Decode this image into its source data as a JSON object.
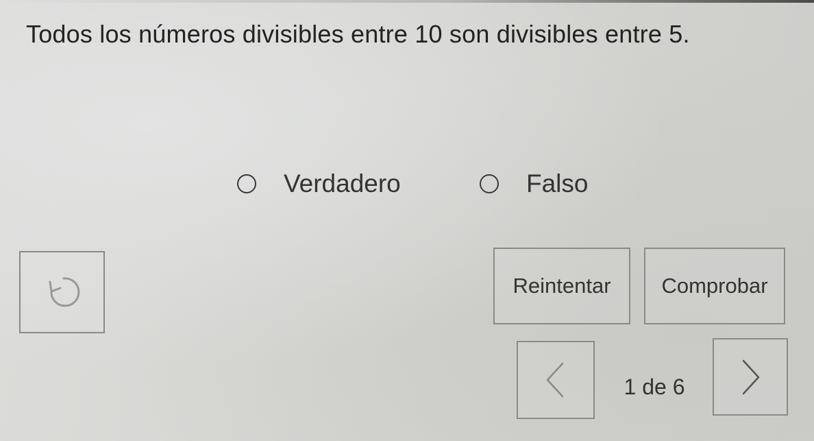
{
  "question": {
    "text": "Todos los números divisibles entre 10 son divisibles entre 5."
  },
  "options": [
    {
      "label": "Verdadero",
      "selected": false
    },
    {
      "label": "Falso",
      "selected": false
    }
  ],
  "actions": {
    "reset_icon": "undo-arrow-icon",
    "retry_label": "Reintentar",
    "check_label": "Comprobar"
  },
  "pagination": {
    "prev_icon": "chevron-left-icon",
    "next_icon": "chevron-right-icon",
    "indicator": "1 de 6",
    "current": 1,
    "total": 6
  }
}
